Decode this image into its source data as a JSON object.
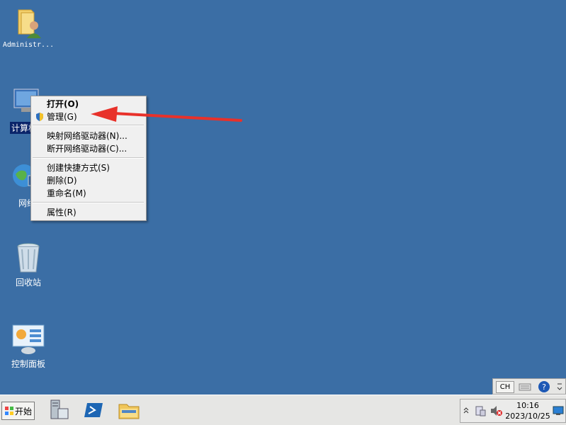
{
  "desktop": {
    "icons": [
      {
        "label": "Administr..."
      },
      {
        "label": "计算机"
      },
      {
        "label": "网络"
      },
      {
        "label": "回收站"
      },
      {
        "label": "控制面板"
      }
    ]
  },
  "context_menu": {
    "open": "打开(O)",
    "manage": "管理(G)",
    "map_drive": "映射网络驱动器(N)...",
    "disconnect_drive": "断开网络驱动器(C)...",
    "create_shortcut": "创建快捷方式(S)",
    "delete": "删除(D)",
    "rename": "重命名(M)",
    "properties": "属性(R)"
  },
  "language_bar": {
    "lang": "CH"
  },
  "taskbar": {
    "start_label": "开始",
    "clock_time": "10:16",
    "clock_date": "2023/10/25"
  },
  "colors": {
    "desktop": "#3b6ea5",
    "arrow": "#e8312a",
    "taskbar": "#e6e6e4"
  }
}
